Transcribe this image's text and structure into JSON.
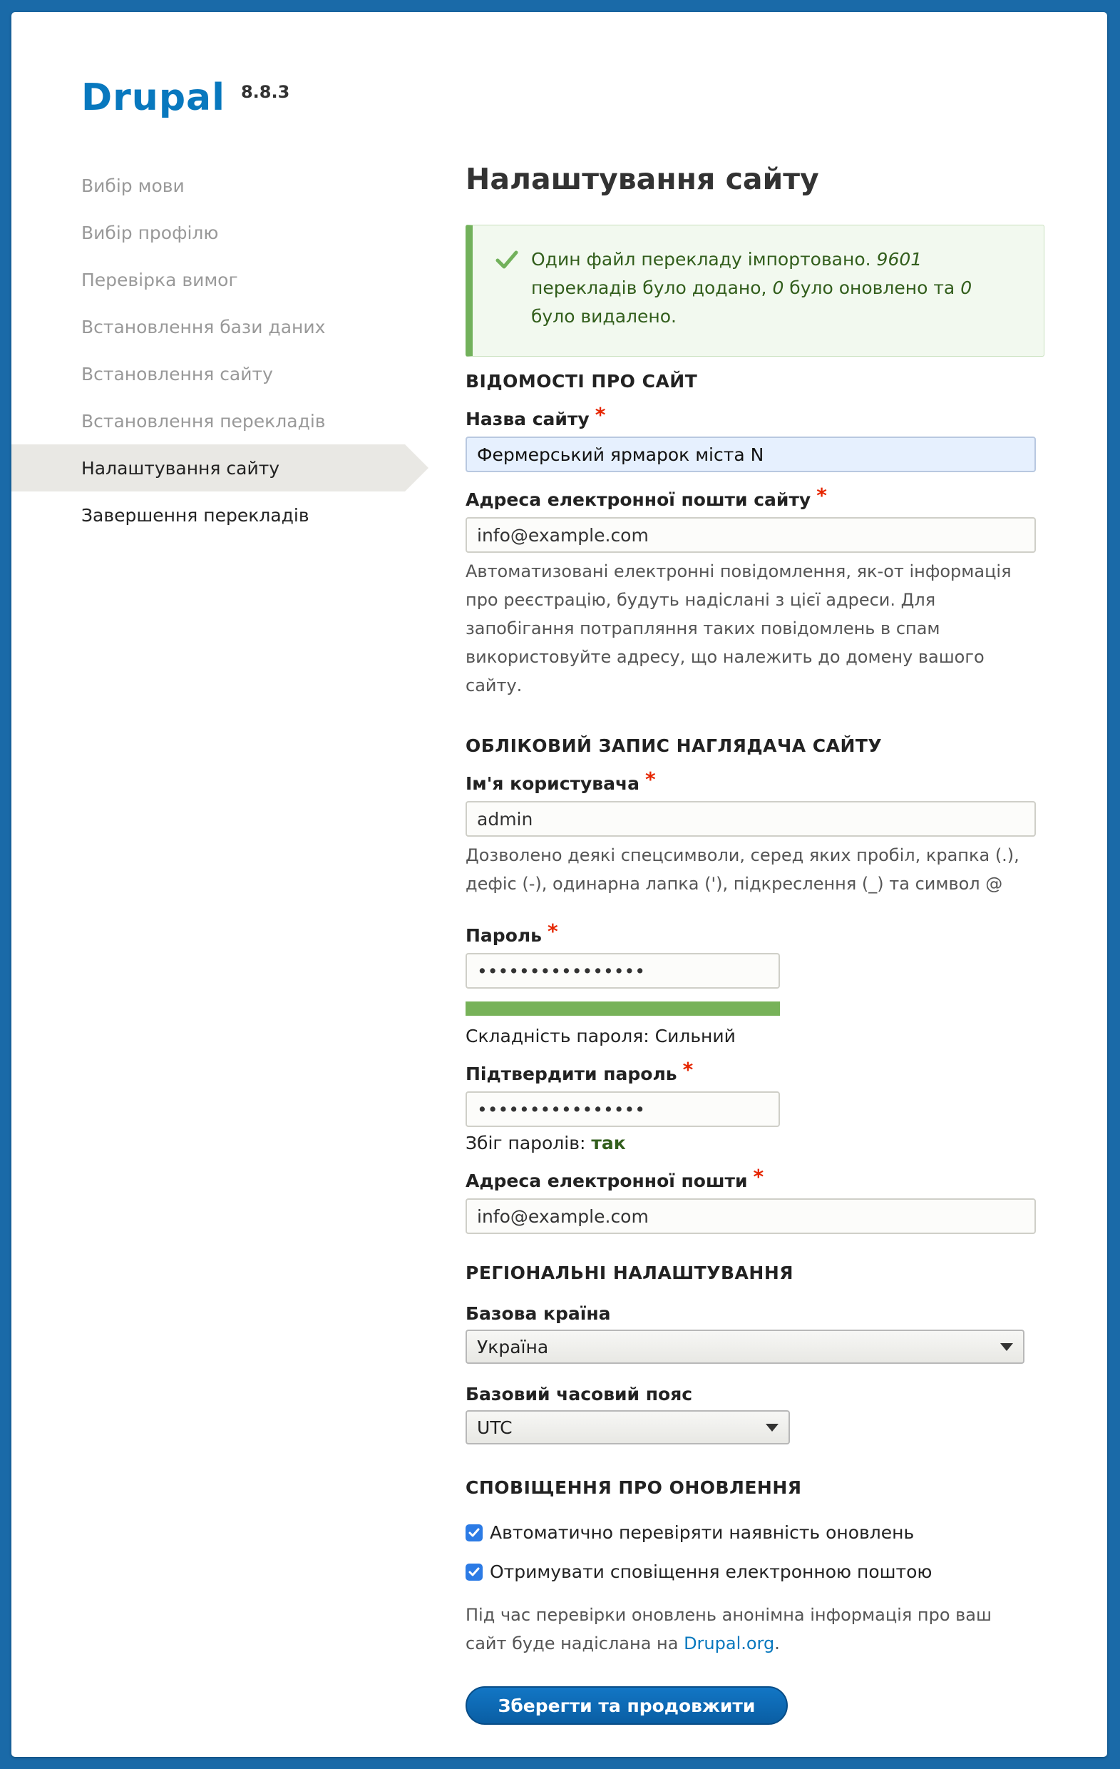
{
  "brand": {
    "name": "Drupal",
    "version": "8.8.3"
  },
  "sidebar": {
    "steps": [
      {
        "label": "Вибір мови",
        "state": "done-muted"
      },
      {
        "label": "Вибір профілю",
        "state": "done-muted"
      },
      {
        "label": "Перевірка вимог",
        "state": "done-muted"
      },
      {
        "label": "Встановлення бази даних",
        "state": "done-muted"
      },
      {
        "label": "Встановлення сайту",
        "state": "done-muted"
      },
      {
        "label": "Встановлення перекладів",
        "state": "done-muted"
      },
      {
        "label": "Налаштування сайту",
        "state": "active"
      },
      {
        "label": "Завершення перекладів",
        "state": "pending"
      }
    ]
  },
  "main": {
    "title": "Налаштування сайту",
    "message": {
      "part1": "Один файл перекладу імпортовано. ",
      "added_count": "9601",
      "part2": " перекладів було додано, ",
      "updated_count": "0",
      "part3": " було оновлено та ",
      "deleted_count": "0",
      "part4": " було видалено."
    },
    "site_info": {
      "heading": "ВІДОМОСТІ ПРО САЙТ",
      "site_name_label": "Назва сайту",
      "site_name_value": "Фермерський ярмарок міста N",
      "site_email_label": "Адреса електронної пошти сайту",
      "site_email_value": "info@example.com",
      "site_email_desc": "Автоматизовані електронні повідомлення, як-от інформація про реєстрацію, будуть надіслані з цієї адреси. Для запобігання потрапляння таких повідомлень в спам використовуйте адресу, що належить до домену вашого сайту."
    },
    "admin_account": {
      "heading": "ОБЛІКОВИЙ ЗАПИС НАГЛЯДАЧА САЙТУ",
      "username_label": "Ім'я користувача",
      "username_value": "admin",
      "username_desc": "Дозволено деякі спецсимволи, серед яких пробіл, крапка (.), дефіс (-), одинарна лапка ('), підкреслення (_) та символ @",
      "password_label": "Пароль",
      "password_value": "••••••••••••••••",
      "strength_label": "Складність пароля: Сильний",
      "strength_level": 1.0,
      "confirm_label": "Підтвердити пароль",
      "confirm_value": "••••••••••••••••",
      "match_label": "Збіг паролів: ",
      "match_value": "так",
      "email_label": "Адреса електронної пошти",
      "email_value": "info@example.com"
    },
    "regional": {
      "heading": "РЕГІОНАЛЬНІ НАЛАШТУВАННЯ",
      "country_label": "Базова країна",
      "country_value": "Україна",
      "timezone_label": "Базовий часовий пояс",
      "timezone_value": "UTC"
    },
    "updates": {
      "heading": "СПОВІЩЕННЯ ПРО ОНОВЛЕННЯ",
      "check_auto_label": "Автоматично перевіряти наявність оновлень",
      "check_auto_checked": true,
      "notify_email_label": "Отримувати сповіщення електронною поштою",
      "notify_email_checked": true,
      "desc_part1": "Під час перевірки оновлень анонімна інформація про ваш сайт буде надіслана на ",
      "desc_link": "Drupal.org",
      "desc_part2": "."
    },
    "submit_label": "Зберегти та продовжити"
  },
  "colors": {
    "background": "#1a6aa8",
    "accent": "#0878be",
    "required": "#e62600",
    "success": "#77b259"
  }
}
